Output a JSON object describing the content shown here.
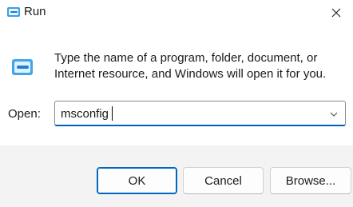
{
  "window": {
    "title": "Run",
    "close_glyph": "×"
  },
  "icons": {
    "app": "run-icon",
    "close": "close-icon",
    "dropdown": "chevron-down-icon"
  },
  "prompt": {
    "line1": "Type the name of a program, folder, document, or",
    "line2": "Internet resource, and Windows will open it for you."
  },
  "open": {
    "label": "Open:",
    "value": "msconfig"
  },
  "buttons": {
    "ok": "OK",
    "cancel": "Cancel",
    "browse": "Browse..."
  },
  "colors": {
    "accent": "#005fb8",
    "default_button_border": "#0067c0",
    "window_bg": "#f3f3f3",
    "content_bg": "#ffffff"
  }
}
